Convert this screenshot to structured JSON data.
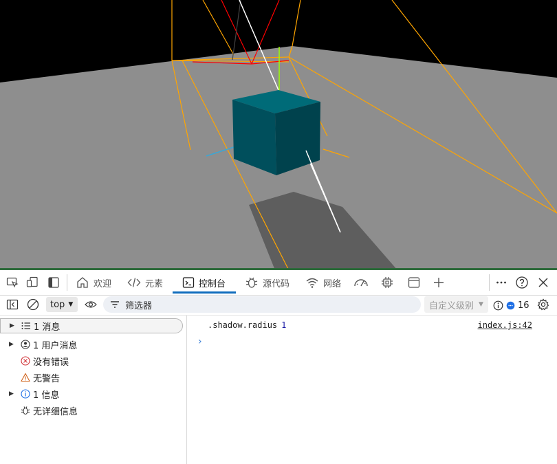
{
  "viewport": {
    "sky_color": "#000000",
    "floor_color": "#8e8e8e",
    "cube_front_color": "#004f5c",
    "cube_top_color": "#006b78",
    "shadow_color": "#5e5e5e",
    "frustum_color": "#ffa500",
    "camera_color": "#ff0000"
  },
  "devtools": {
    "tabs": [
      {
        "label": "欢迎",
        "icon": "home-icon"
      },
      {
        "label": "元素",
        "icon": "code-icon"
      },
      {
        "label": "控制台",
        "icon": "console-icon"
      },
      {
        "label": "源代码",
        "icon": "bug-icon"
      },
      {
        "label": "网络",
        "icon": "wifi-icon"
      }
    ],
    "context": "top",
    "filter_placeholder": "筛选器",
    "levels_label": "自定义级别",
    "issues_count": "16",
    "accent_color": "#0f6cbd"
  },
  "sidebar": {
    "items": [
      {
        "label": "1 消息"
      },
      {
        "label": "1 用户消息"
      },
      {
        "label": "没有错误"
      },
      {
        "label": "无警告"
      },
      {
        "label": "1 信息"
      },
      {
        "label": "无详细信息"
      }
    ]
  },
  "console": {
    "log_text": ".shadow.radius",
    "log_value": "1",
    "log_source": "index.js:42",
    "prompt": "›"
  }
}
